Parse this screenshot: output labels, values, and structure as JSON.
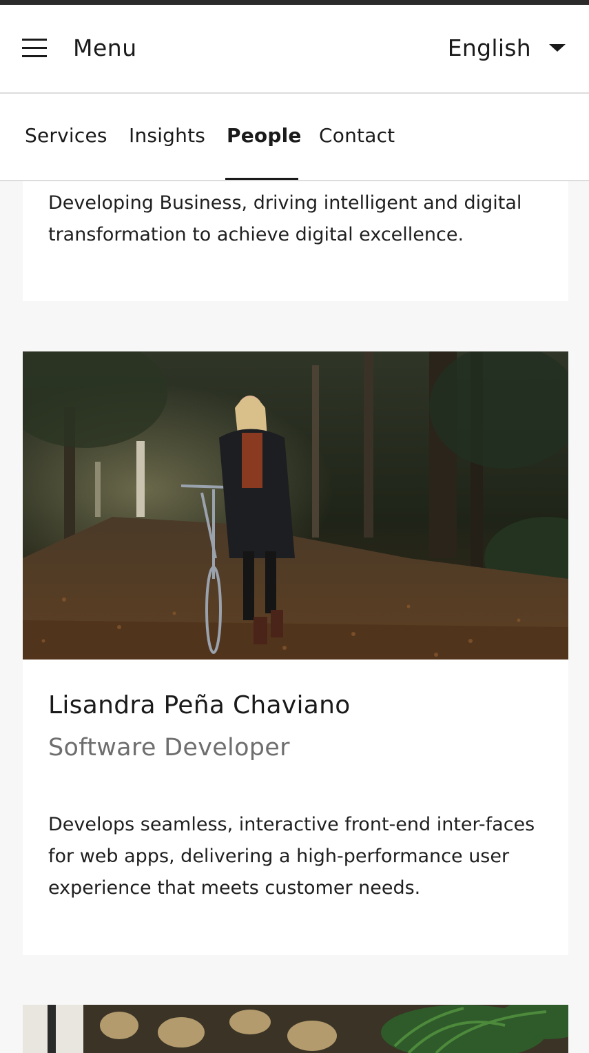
{
  "header": {
    "menu_label": "Menu",
    "language_label": "English"
  },
  "tabs": [
    {
      "label": "Services",
      "active": false
    },
    {
      "label": "Insights",
      "active": false
    },
    {
      "label": "People",
      "active": true
    },
    {
      "label": "Contact",
      "active": false
    }
  ],
  "cards": {
    "previous": {
      "description": "Developing Business, driving intelligent and digital transformation to achieve digital excellence."
    },
    "current": {
      "name": "Lisandra Peña Chaviano",
      "role": "Software Developer",
      "description": "Develops seamless, interactive front-end inter-faces for web apps, delivering a high-performance user experience that meets customer needs."
    }
  },
  "colors": {
    "top_bar": "#2b2b2b",
    "page_background": "#f7f7f7",
    "role_text": "#6e6e6e"
  }
}
